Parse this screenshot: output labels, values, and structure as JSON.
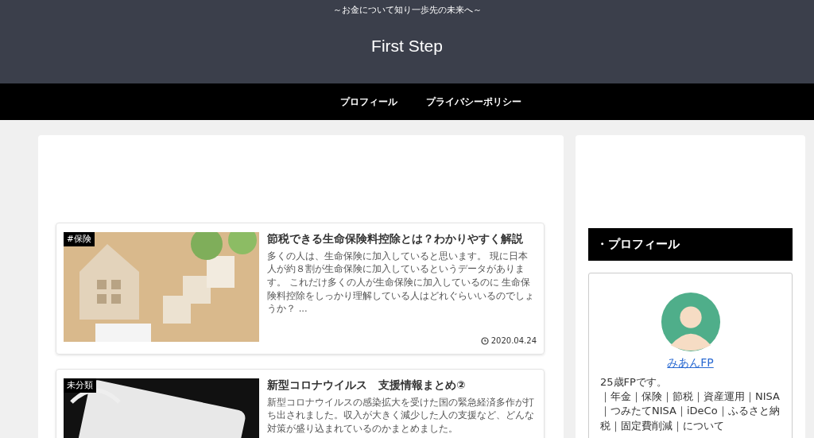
{
  "header": {
    "tagline": "～お金について知り一歩先の未来へ～",
    "site_title": "First Step"
  },
  "nav": {
    "items": [
      {
        "label": "プロフィール"
      },
      {
        "label": "プライバシーポリシー"
      }
    ]
  },
  "articles": [
    {
      "category": "#保険",
      "title": "節税できる生命保険料控除とは？わかりやすく解説",
      "excerpt": "多くの人は、生命保険に加入していると思います。 現に日本人が約８割が生命保険に加入しているというデータがあります。 これだけ多くの人が生命保険に加入しているのに 生命保険料控除をしっかり理解している人はどれぐらいいるのでしょうか？ ...",
      "date": "2020.04.24",
      "kind": "blocks"
    },
    {
      "category": "未分類",
      "title": "新型コロナウイルス　支援情報まとめ②",
      "excerpt": "新型コロナウイルスの感染拡大を受けた国の緊急経済多作が打ち出されました。収入が大きく減少した人の支援など、どんな対策が盛り込まれているのかまとめました。",
      "kind": "masks"
    }
  ],
  "sidebar": {
    "heading": "・プロフィール",
    "profile": {
      "name": "みあんFP",
      "bio": [
        "25歳FPです。",
        "｜年金｜保険｜節税｜資産運用｜NISA｜つみたてNISA｜iDeCo｜ふるさと納税｜固定費削減｜について"
      ]
    }
  }
}
